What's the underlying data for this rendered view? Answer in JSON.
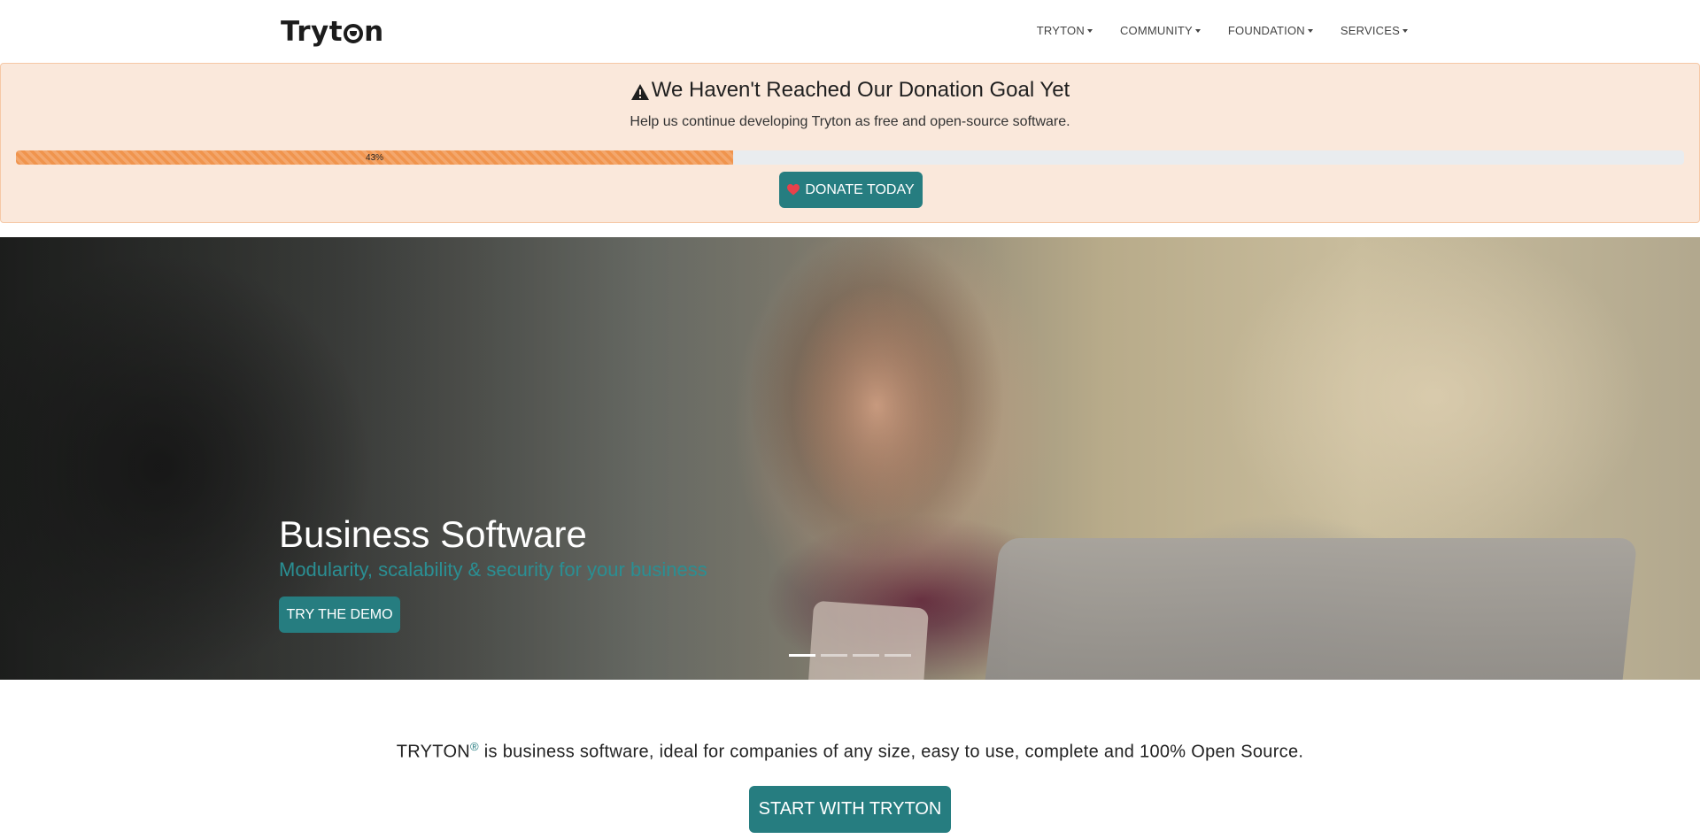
{
  "header": {
    "logo_parts": [
      "Tryt",
      "n"
    ],
    "logo_text": "Tryton",
    "nav": [
      {
        "label": "TRYTON"
      },
      {
        "label": "COMMUNITY"
      },
      {
        "label": "FOUNDATION"
      },
      {
        "label": "SERVICES"
      }
    ]
  },
  "donation": {
    "title": "We Haven't Reached Our Donation Goal Yet",
    "subtitle": "Help us continue developing Tryton as free and open-source software.",
    "progress_percent": 43,
    "progress_label": "43%",
    "button_label": "DONATE TODAY",
    "bg_color": "#fae8db",
    "bar_color": "#f0944d"
  },
  "hero": {
    "title": "Business Software",
    "subtitle": "Modularity, scalability & security for your business",
    "button_label": "TRY THE DEMO",
    "slides_count": 4,
    "active_slide": 0
  },
  "intro": {
    "brand": "TRYTON",
    "registered_mark": "®",
    "text": " is business software, ideal for companies of any size, easy to use, complete and 100% Open Source.",
    "button_label": "START WITH TRYTON"
  },
  "colors": {
    "accent": "#267d80",
    "accent_text": "#2a8f93"
  },
  "icons": [
    "warning-icon",
    "heart-icon",
    "caret-down-icon"
  ]
}
